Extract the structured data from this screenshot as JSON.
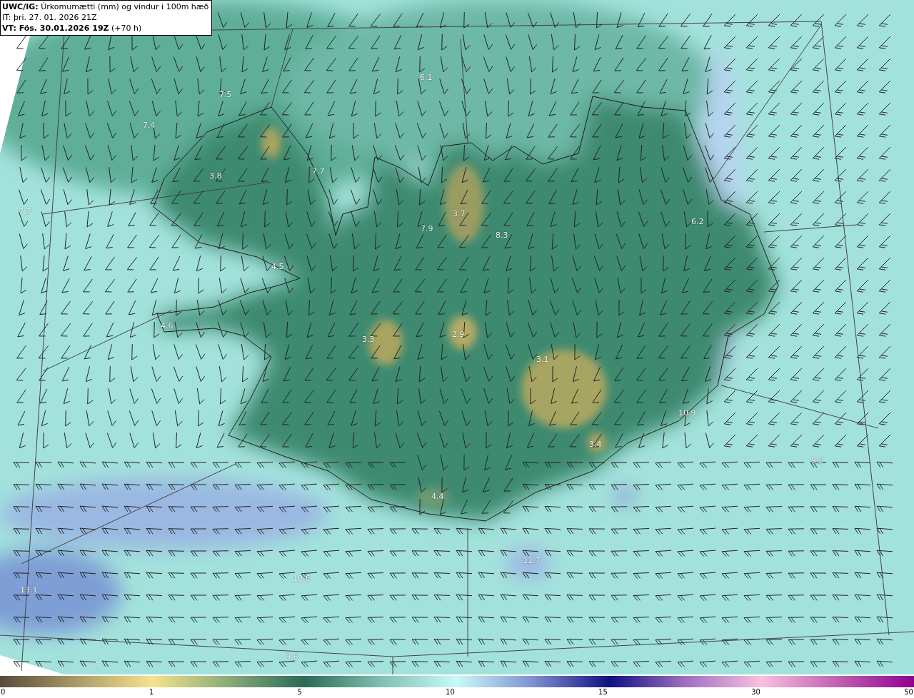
{
  "header": {
    "title": "**UWC/IG:** Úrkomumætti (mm) og vindur i 100m hæð",
    "issue_time": "IT: þri. 27. 01. 2026 21Z",
    "valid_time": "**VT: Fös. 30.01.2026 19Z** (+70 h)"
  },
  "map_values": [
    "6.1",
    "7.5",
    "7.4",
    "3.8",
    "7.7",
    "7.7",
    "3.7",
    "7.9",
    "8.3",
    "6.2",
    "4.5",
    "4.6",
    "3.3",
    "2.9",
    "3.1",
    "3.4",
    "4.4",
    "13.1",
    "10.6",
    "9.6",
    "9.2",
    "11.7",
    "10.9"
  ],
  "colorbar": {
    "ticks": [
      "0",
      "1",
      "5",
      "10",
      "15",
      "30",
      "50"
    ]
  }
}
